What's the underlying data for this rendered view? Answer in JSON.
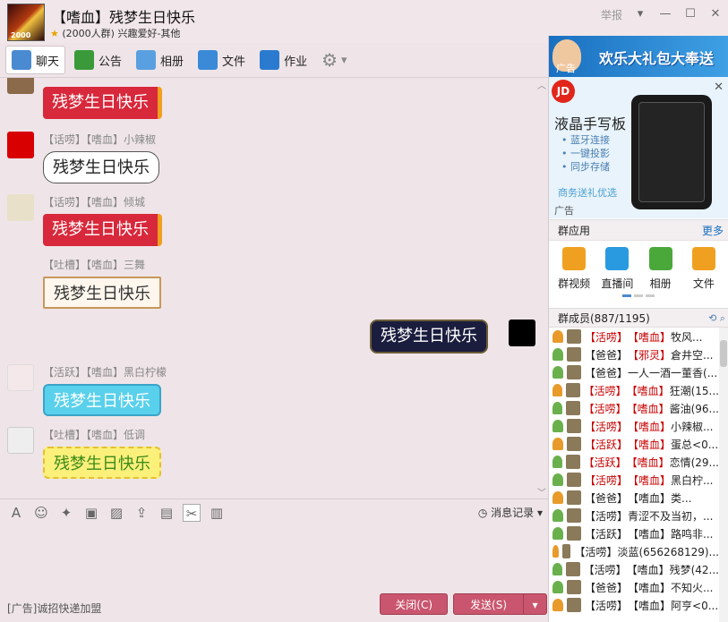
{
  "window": {
    "group_name": "【嗜血】残梦生日快乐",
    "group_meta": "(2000人群) 兴趣爱好-其他",
    "avatar_text": "2000",
    "report": "举报",
    "controls": [
      "▾",
      "—",
      "☐",
      "✕"
    ]
  },
  "tabs": [
    {
      "label": "聊天",
      "icon": "chat-icon",
      "active": true
    },
    {
      "label": "公告",
      "icon": "announcement-icon"
    },
    {
      "label": "相册",
      "icon": "album-icon"
    },
    {
      "label": "文件",
      "icon": "folder-icon"
    },
    {
      "label": "作业",
      "icon": "homework-icon"
    }
  ],
  "messages": [
    {
      "tag": "",
      "text": "残梦生日快乐",
      "style": "red"
    },
    {
      "tag": "【话唠】【嗜血】小辣椒",
      "text": "残梦生日快乐",
      "style": "cloud"
    },
    {
      "tag": "【话唠】【嗜血】倾城",
      "text": "残梦生日快乐",
      "style": "red"
    },
    {
      "tag": "【吐槽】【嗜血】三舞",
      "text": "残梦生日快乐",
      "style": "frame"
    },
    {
      "tag": "【活跃】【嗜血】黑白柠檬",
      "text": "残梦生日快乐",
      "style": "cyan"
    },
    {
      "tag": "【吐槽】【嗜血】低调",
      "text": "残梦生日快乐",
      "style": "yellow"
    }
  ],
  "my_message": {
    "text": "残梦生日快乐"
  },
  "toolbar": {
    "history_label": "消息记录"
  },
  "footer": {
    "ad_text": "[广告]诚招快递加盟",
    "close_label": "关闭(C)",
    "send_label": "发送(S)"
  },
  "sidebar": {
    "banner_ad_tag": "广告",
    "banner_ad_text": "欢乐大礼包大奉送",
    "jd": {
      "logo": "JD",
      "title": "液晶手写板",
      "features": [
        "蓝牙连接",
        "一键投影",
        "同步存储"
      ],
      "note": "商务送礼优选",
      "ad_tag": "广告"
    },
    "apps_header": "群应用",
    "apps_more": "更多",
    "apps": [
      {
        "label": "群视频",
        "color": "#f0a020"
      },
      {
        "label": "直播间",
        "color": "#2a9ae0"
      },
      {
        "label": "相册",
        "color": "#4aa83a"
      },
      {
        "label": "文件",
        "color": "#f0a020"
      }
    ],
    "members_header": "群成员(887/1195)",
    "members": [
      {
        "t1": "【活唠】",
        "t2": "【嗜血】",
        "name": "牧风..."
      },
      {
        "t1": "【爸爸】",
        "t2": "【邪灵】",
        "name": "倉井空..."
      },
      {
        "t1": "【爸爸】",
        "t2": "",
        "name": "一人一酒一董香(..."
      },
      {
        "t1": "【活唠】",
        "t2": "【嗜血】",
        "name": "狂潮(15..."
      },
      {
        "t1": "【活唠】",
        "t2": "【嗜血】",
        "name": "酱油(96..."
      },
      {
        "t1": "【活唠】",
        "t2": "【嗜血】",
        "name": "小辣椒..."
      },
      {
        "t1": "【活跃】",
        "t2": "【嗜血】",
        "name": "蛋总<0..."
      },
      {
        "t1": "【活跃】",
        "t2": "【嗜血】",
        "name": "恋情(29..."
      },
      {
        "t1": "【活唠】",
        "t2": "【嗜血】",
        "name": "黑白柠..."
      },
      {
        "t1": "【爸爸】",
        "t2": "【嗜血】",
        "name": "类..."
      },
      {
        "t1": "【活唠】",
        "t2": "",
        "name": "青涩不及当初，..."
      },
      {
        "t1": "【活跃】",
        "t2": "【嗜血】",
        "name": "路鸣非..."
      },
      {
        "t1": "【活唠】",
        "t2": "",
        "name": "淡蓝(656268129)..."
      },
      {
        "t1": "【活唠】",
        "t2": "【嗜血】",
        "name": "残梦(42..."
      },
      {
        "t1": "【爸爸】",
        "t2": "【嗜血】",
        "name": "不知火..."
      },
      {
        "t1": "【活唠】",
        "t2": "【嗜血】",
        "name": "阿亨<0..."
      }
    ]
  }
}
